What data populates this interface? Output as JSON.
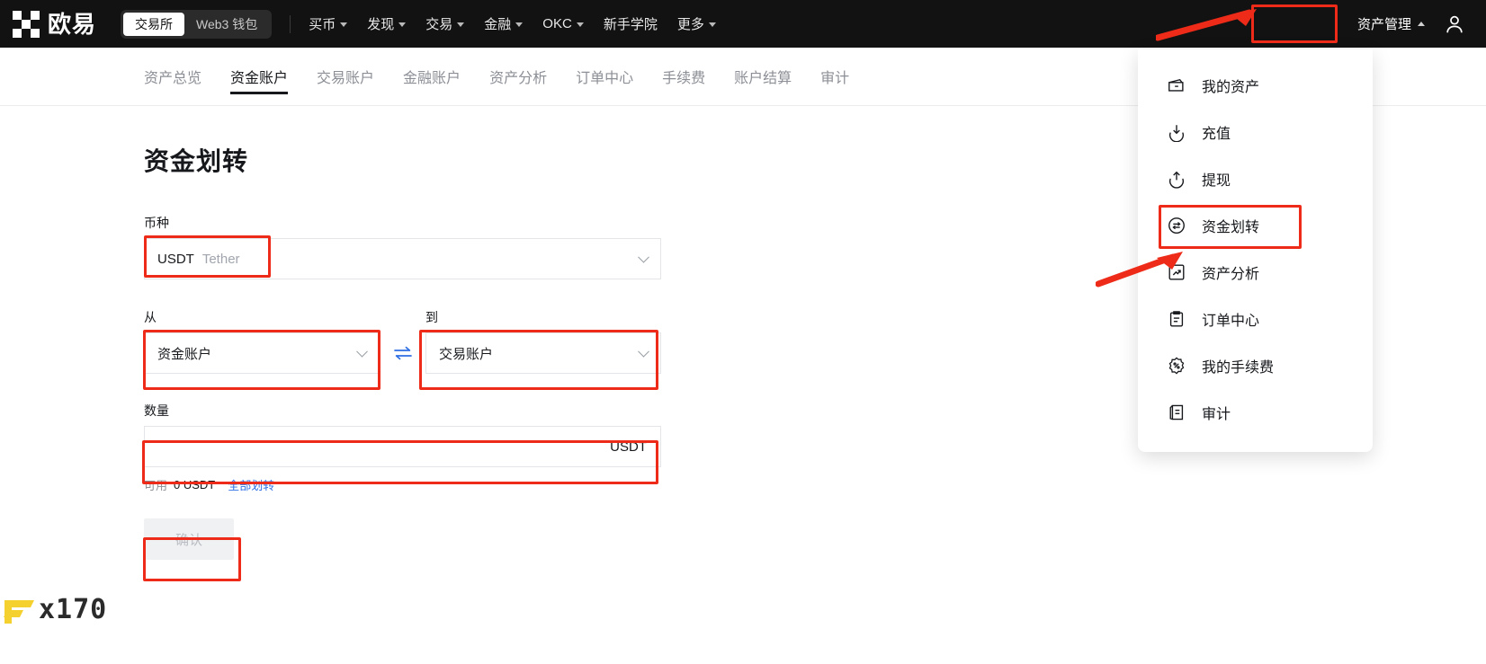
{
  "header": {
    "brand_name": "欧易",
    "brand_logo_icon": "okx-logo-icon",
    "segments": [
      {
        "label": "交易所",
        "active": true
      },
      {
        "label": "Web3 钱包",
        "active": false
      }
    ],
    "nav": [
      {
        "label": "买币",
        "has_caret": true
      },
      {
        "label": "发现",
        "has_caret": true
      },
      {
        "label": "交易",
        "has_caret": true
      },
      {
        "label": "金融",
        "has_caret": true
      },
      {
        "label": "OKC",
        "has_caret": true
      },
      {
        "label": "新手学院",
        "has_caret": false
      },
      {
        "label": "更多",
        "has_caret": true
      }
    ],
    "asset_management": "资产管理",
    "caret_up_icon": "chevron-up-icon",
    "user_icon": "user-account-icon"
  },
  "subnav": {
    "items": [
      {
        "label": "资产总览",
        "active": false
      },
      {
        "label": "资金账户",
        "active": true
      },
      {
        "label": "交易账户",
        "active": false
      },
      {
        "label": "金融账户",
        "active": false
      },
      {
        "label": "资产分析",
        "active": false
      },
      {
        "label": "订单中心",
        "active": false
      },
      {
        "label": "手续费",
        "active": false
      },
      {
        "label": "账户结算",
        "active": false
      },
      {
        "label": "审计",
        "active": false
      }
    ]
  },
  "transfer_form": {
    "title": "资金划转",
    "currency_label": "币种",
    "currency_value": "USDT",
    "currency_sub": "Tether",
    "currency_chevron_icon": "chevron-down-icon",
    "from_label": "从",
    "from_value": "资金账户",
    "swap_icon": "swap-arrows-icon",
    "to_label": "到",
    "to_value": "交易账户",
    "amount_label": "数量",
    "amount_value": "",
    "amount_placeholder": "",
    "amount_suffix": "USDT",
    "available_label": "可用",
    "available_value": "0 USDT",
    "transfer_all_label": "全部划转",
    "confirm_label": "确认",
    "confirm_disabled": true
  },
  "dropdown": {
    "items": [
      {
        "label": "我的资产",
        "icon": "wallet-icon",
        "highlighted": false
      },
      {
        "label": "充值",
        "icon": "deposit-arrow-down-icon",
        "highlighted": false
      },
      {
        "label": "提现",
        "icon": "withdraw-arrow-up-icon",
        "highlighted": false
      },
      {
        "label": "资金划转",
        "icon": "transfer-circle-icon",
        "highlighted": true
      },
      {
        "label": "资产分析",
        "icon": "analysis-chart-icon",
        "highlighted": false
      },
      {
        "label": "订单中心",
        "icon": "order-clipboard-icon",
        "highlighted": false
      },
      {
        "label": "我的手续费",
        "icon": "percent-badge-icon",
        "highlighted": false
      },
      {
        "label": "审计",
        "icon": "audit-document-icon",
        "highlighted": false
      }
    ]
  },
  "watermark": {
    "text": "x170",
    "logo_icon": "fx-logo-icon"
  },
  "annotations": {
    "color": "#ee2b18",
    "boxes": [
      {
        "name": "asset-management-highlight"
      },
      {
        "name": "currency-field-highlight"
      },
      {
        "name": "from-account-highlight"
      },
      {
        "name": "to-account-highlight"
      },
      {
        "name": "amount-field-highlight"
      },
      {
        "name": "confirm-button-highlight"
      },
      {
        "name": "dropdown-transfer-highlight"
      }
    ],
    "arrows": [
      {
        "name": "arrow-to-asset-management"
      },
      {
        "name": "arrow-to-dropdown-transfer"
      }
    ]
  }
}
